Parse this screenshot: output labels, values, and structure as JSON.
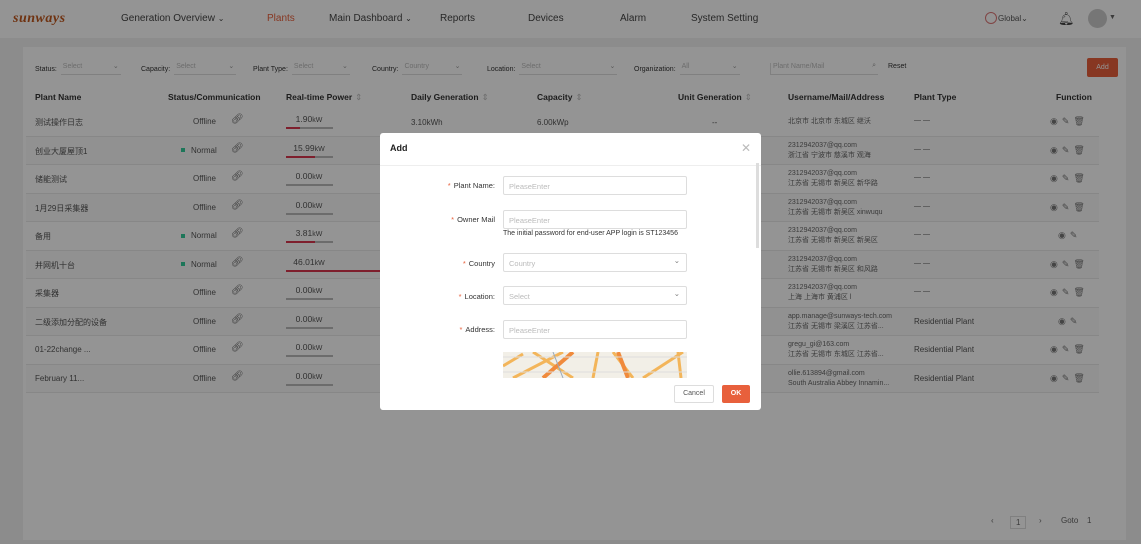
{
  "header": {
    "logo": "sunways",
    "nav": [
      {
        "label": "Generation Overview",
        "caret": true
      },
      {
        "label": "Plants",
        "active": true
      },
      {
        "label": "Main Dashboard",
        "caret": true
      },
      {
        "label": "Reports"
      },
      {
        "label": "Devices"
      },
      {
        "label": "Alarm"
      },
      {
        "label": "System Setting"
      }
    ],
    "region": "Global"
  },
  "filters": {
    "status": {
      "label": "Status:",
      "value": "Select"
    },
    "capacity": {
      "label": "Capacity:",
      "value": "Select"
    },
    "plant_type": {
      "label": "Plant Type:",
      "value": "Select"
    },
    "country": {
      "label": "Country:",
      "value": "Country"
    },
    "location": {
      "label": "Location:",
      "value": "Select"
    },
    "organization": {
      "label": "Organization:",
      "value": "All"
    },
    "search_placeholder": "Plant Name/Mail",
    "reset": "Reset",
    "add": "Add"
  },
  "table": {
    "headers": {
      "name": "Plant Name",
      "status": "Status/Communication",
      "power": "Real-time Power",
      "daily": "Daily Generation",
      "capacity": "Capacity",
      "unit": "Unit Generation",
      "user": "Username/Mail/Address",
      "type": "Plant Type",
      "function": "Function"
    },
    "rows": [
      {
        "name": "测试操作日志",
        "status": "Offline",
        "power": "1.90",
        "power_frac": 0.3,
        "daily": "3.10kWh",
        "capacity": "6.00kWp",
        "unit": "--",
        "mail": "",
        "addr": "北京市 北京市 东城区 继沃",
        "type": "— —",
        "delete": true
      },
      {
        "name": "创业大厦屋顶1",
        "status": "Normal",
        "power": "15.99",
        "power_frac": 0.62,
        "mail": "2312942037@qq.com",
        "addr": "浙江省 宁波市 慈溪市 观海",
        "type": "— —",
        "delete": true
      },
      {
        "name": "储能测试",
        "status": "Offline",
        "power": "0.00",
        "power_frac": 0,
        "mail": "2312942037@qq.com",
        "addr": "江苏省 无锡市 新吴区 新华路",
        "type": "— —",
        "delete": true
      },
      {
        "name": "1月29日采集器",
        "status": "Offline",
        "power": "0.00",
        "power_frac": 0,
        "mail": "2312942037@qq.com",
        "addr": "江苏省 无锡市 新吴区 xinwuqu",
        "type": "— —",
        "delete": true
      },
      {
        "name": "备用",
        "status": "Normal",
        "power": "3.81",
        "power_frac": 0.62,
        "mail": "2312942037@qq.com",
        "addr": "江苏省 无锡市 新吴区 新吴区",
        "type": "— —",
        "delete": false
      },
      {
        "name": "并网机十台",
        "status": "Normal",
        "power": "46.01",
        "power_frac": 2.0,
        "mail": "2312942037@qq.com",
        "addr": "江苏省 无锡市 新吴区 和风路",
        "type": "— —",
        "delete": true
      },
      {
        "name": "采集器",
        "status": "Offline",
        "power": "0.00",
        "power_frac": 0,
        "mail": "2312942037@qq.com",
        "addr": "上海 上海市 黄浦区 l",
        "type": "— —",
        "delete": true
      },
      {
        "name": "二级添加分配的设备",
        "status": "Offline",
        "power": "0.00",
        "power_frac": 0,
        "mail": "app.manage@sunways-tech.com",
        "addr": "江苏省 无锡市 梁溪区 江苏省...",
        "type": "Residential Plant",
        "delete": false
      },
      {
        "name": "01-22change ...",
        "status": "Offline",
        "power": "0.00",
        "power_frac": 0,
        "mail": "gregu_gi@163.com",
        "addr": "江苏省 无锡市 东城区 江苏省...",
        "type": "Residential Plant",
        "delete": true
      },
      {
        "name": "February 11...",
        "status": "Offline",
        "power": "0.00",
        "power_frac": 0,
        "mail": "ollie.613894@gmail.com",
        "addr": "South Australia Abbey Innamin...",
        "type": "Residential Plant",
        "delete": true
      }
    ],
    "power_unit": "kW"
  },
  "pagination": {
    "page": "1",
    "goto_label": "Goto",
    "goto_value": "1"
  },
  "modal": {
    "title": "Add",
    "fields": {
      "plant_name": {
        "label": "Plant Name:",
        "placeholder": "PleaseEnter"
      },
      "owner_mail": {
        "label": "Owner Mail",
        "placeholder": "PleaseEnter"
      },
      "country": {
        "label": "Country",
        "placeholder": "Country"
      },
      "location": {
        "label": "Location:",
        "placeholder": "Select"
      },
      "address": {
        "label": "Address:",
        "placeholder": "PleaseEnter"
      }
    },
    "hint": "The initial password for end-user APP login is ST123456",
    "cancel": "Cancel",
    "ok": "OK"
  },
  "colors": {
    "accent": "#e8603c",
    "power_bar": "#d9364f",
    "normal": "#33cc99"
  }
}
